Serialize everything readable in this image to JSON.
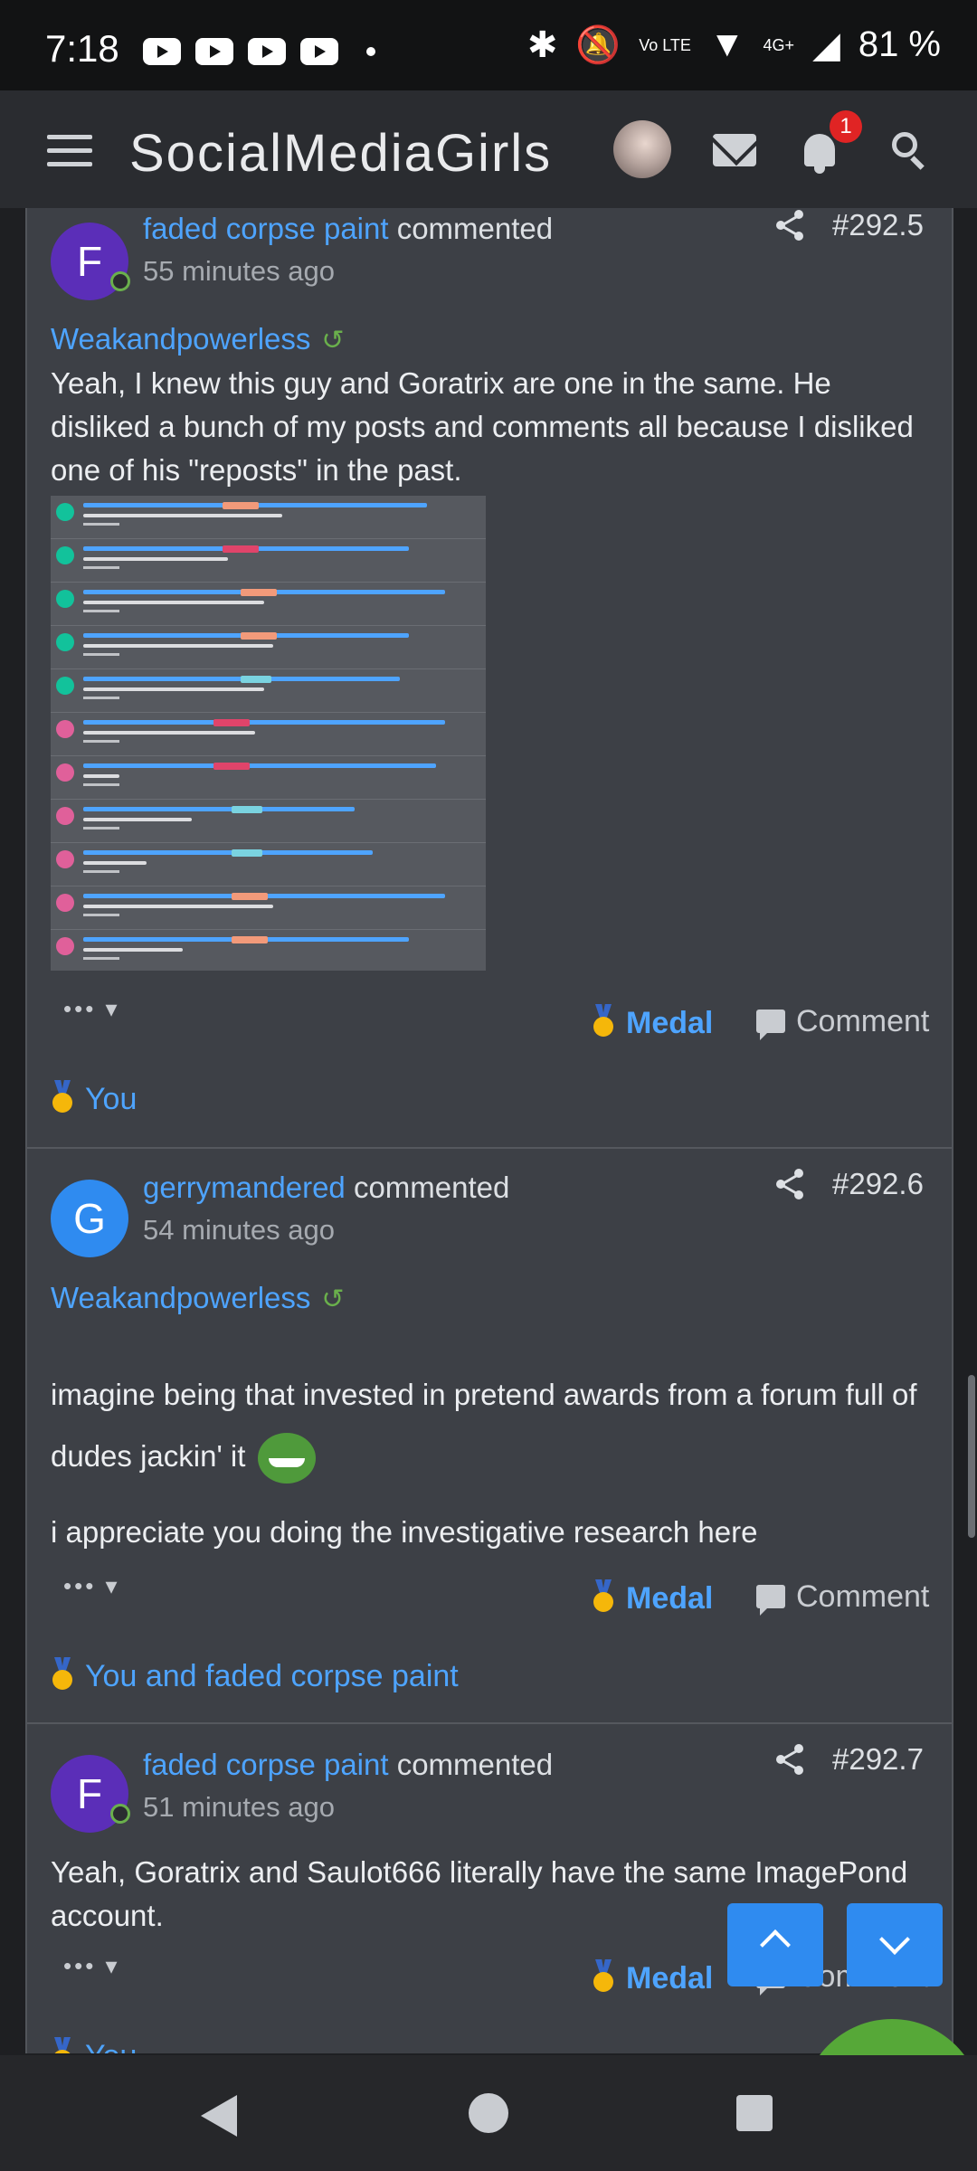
{
  "status_bar": {
    "time": "7:18",
    "volte": "Vo LTE",
    "network": "4G+",
    "battery": "81 %"
  },
  "app_bar": {
    "title": "SocialMediaGirls",
    "notification_count": "1"
  },
  "posts": [
    {
      "avatar_letter": "F",
      "avatar_color": "#5b2eb8",
      "username": "faded corpse paint",
      "action": "commented",
      "time_ago": "55 minutes ago",
      "post_number": "#292.5",
      "quote_user": "Weakandpowerless",
      "body": "Yeah, I knew this guy and Goratrix are one in the same. He disliked a bunch of my posts and comments all because I disliked one of his \"reposts\" in the past.",
      "medal_label": "Medal",
      "comment_label": "Comment",
      "reactions": "You"
    },
    {
      "avatar_letter": "G",
      "avatar_color": "#2f8bf0",
      "username": "gerrymandered",
      "action": "commented",
      "time_ago": "54 minutes ago",
      "post_number": "#292.6",
      "quote_user": "Weakandpowerless",
      "body_line1": "imagine being that invested in pretend awards from a forum full of dudes jackin' it",
      "body_line2": "i appreciate you doing the investigative research here",
      "medal_label": "Medal",
      "comment_label": "Comment",
      "reactions": "You and faded corpse paint"
    },
    {
      "avatar_letter": "F",
      "avatar_color": "#5b2eb8",
      "username": "faded corpse paint",
      "action": "commented",
      "time_ago": "51 minutes ago",
      "post_number": "#292.7",
      "body": "Yeah, Goratrix and Saulot666 literally have the same ImagePond account.",
      "medal_label": "Medal",
      "comment_label": "Comment",
      "reactions": "You"
    }
  ],
  "colors": {
    "link": "#4ea4ff",
    "background": "#3d4046",
    "online": "#6ab04c",
    "badge": "#e02424"
  }
}
